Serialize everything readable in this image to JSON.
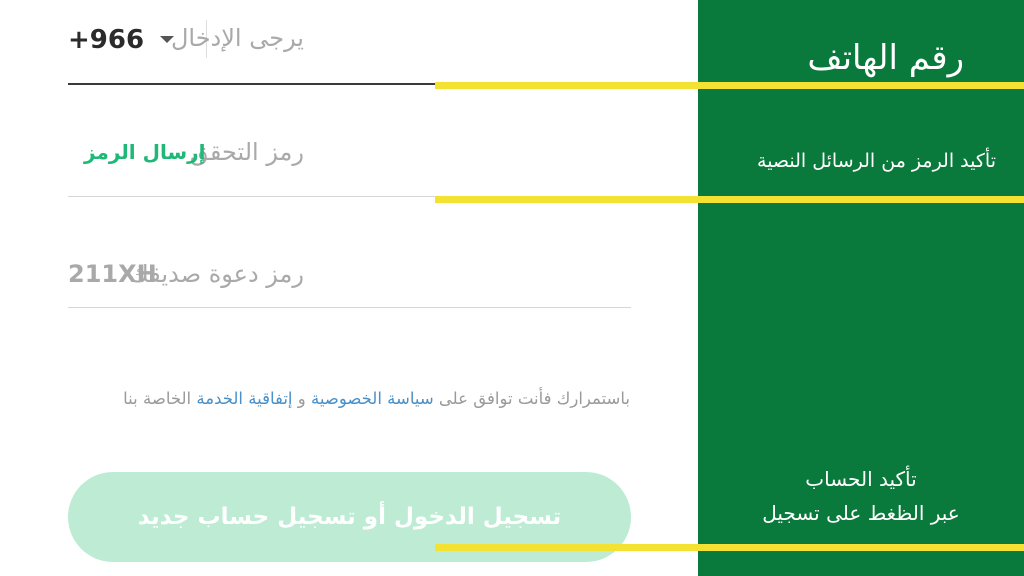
{
  "phone": {
    "country_code": "+966",
    "placeholder": "يرجى الإدخال"
  },
  "verification": {
    "placeholder": "رمز التحقق",
    "send_code_label": "إرسال الرمز"
  },
  "invite": {
    "placeholder": "رمز دعوة صديقك",
    "value": "211XH"
  },
  "terms": {
    "prefix": "باستمرارك فأنت توافق على",
    "privacy_link": "سياسة الخصوصية",
    "conjunction": "و",
    "service_link": "إتفاقية الخدمة",
    "suffix": "الخاصة بنا"
  },
  "login_button_label": "تسجيل الدخول أو تسجيل حساب جديد",
  "side_panel": {
    "phone_label": "رقم الهاتف",
    "sms_label": "تأكيد الرمز من الرسائل النصية",
    "confirm_line1": "تأكيد الحساب",
    "confirm_line2": "عبر الظغط على تسجيل"
  },
  "colors": {
    "panel_green": "#0a7a3c",
    "accent_green": "#1fb877",
    "button_disabled": "#bdebd4",
    "link_blue": "#4a90c8",
    "callout_yellow": "#f3e232"
  }
}
